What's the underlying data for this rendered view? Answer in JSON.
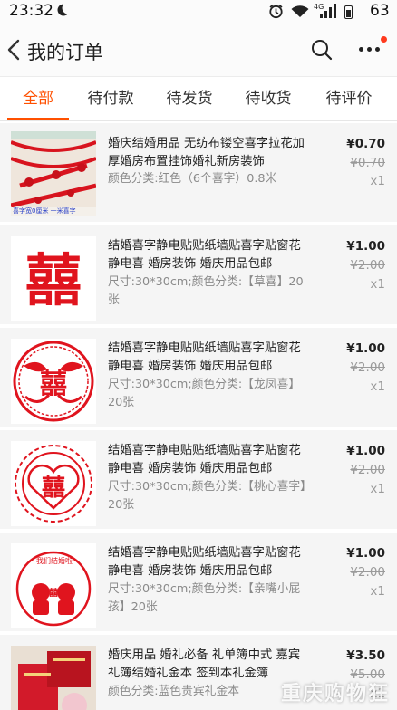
{
  "status_bar": {
    "time": "23:32",
    "network": "4G",
    "battery": "63"
  },
  "header": {
    "title": "我的订单"
  },
  "tabs": [
    {
      "label": "全部",
      "active": true
    },
    {
      "label": "待付款",
      "active": false
    },
    {
      "label": "待发货",
      "active": false
    },
    {
      "label": "待收货",
      "active": false
    },
    {
      "label": "待评价",
      "active": false
    }
  ],
  "orders": [
    {
      "name": "婚庆结婚用品 无纺布镂空喜字拉花加厚婚房布置挂饰婚礼新房装饰",
      "spec": "颜色分类:红色（6个喜字）0.8米",
      "price": "¥0.70",
      "original_price": "¥0.70",
      "quantity": "x1",
      "thumb_caption": "喜字宽0厘米 一米喜字"
    },
    {
      "name": "结婚喜字静电贴贴纸墙贴喜字贴窗花静电喜 婚房装饰 婚庆用品包邮",
      "spec": "尺寸:30*30cm;颜色分类:【草喜】20张",
      "price": "¥1.00",
      "original_price": "¥2.00",
      "quantity": "x1"
    },
    {
      "name": "结婚喜字静电贴贴纸墙贴喜字贴窗花静电喜 婚房装饰 婚庆用品包邮",
      "spec": "尺寸:30*30cm;颜色分类:【龙凤喜】20张",
      "price": "¥1.00",
      "original_price": "¥2.00",
      "quantity": "x1"
    },
    {
      "name": "结婚喜字静电贴贴纸墙贴喜字贴窗花静电喜 婚房装饰 婚庆用品包邮",
      "spec": "尺寸:30*30cm;颜色分类:【桃心喜字】20张",
      "price": "¥1.00",
      "original_price": "¥2.00",
      "quantity": "x1"
    },
    {
      "name": "结婚喜字静电贴贴纸墙贴喜字贴窗花静电喜 婚房装饰 婚庆用品包邮",
      "spec": "尺寸:30*30cm;颜色分类:【亲嘴小屁孩】20张",
      "price": "¥1.00",
      "original_price": "¥2.00",
      "quantity": "x1",
      "thumb_caption": "我们结婚啦"
    },
    {
      "name": "婚庆用品 婚礼必备 礼单簿中式 嘉宾礼簿结婚礼金本 签到本礼金簿",
      "spec": "颜色分类:蓝色贵宾礼金本",
      "price": "¥3.50",
      "original_price": "¥5.00",
      "quantity": "x1"
    }
  ],
  "watermark": "重庆购物狂",
  "colors": {
    "accent": "#ff5000",
    "stamp_red": "#e0141e",
    "notification_dot": "#ff3a1e"
  }
}
